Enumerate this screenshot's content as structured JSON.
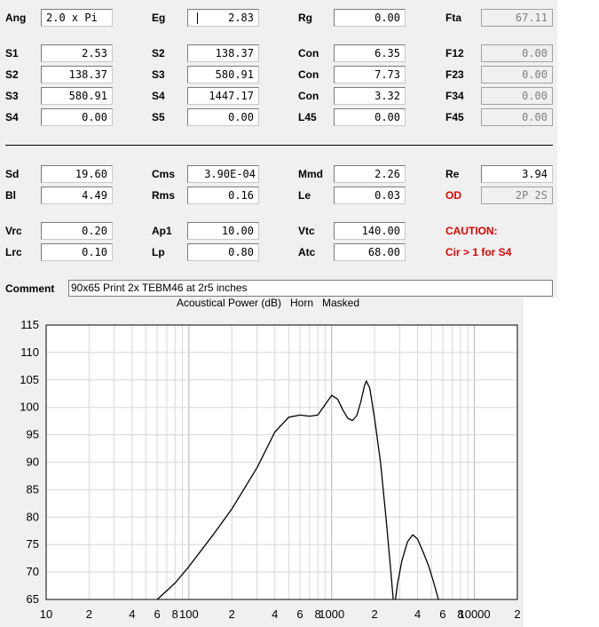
{
  "params": {
    "ang": {
      "label": "Ang",
      "value": "2.0 x Pi"
    },
    "eg": {
      "label": "Eg",
      "value": "2.83"
    },
    "rg": {
      "label": "Rg",
      "value": "0.00"
    },
    "fta": {
      "label": "Fta",
      "value": "67.11"
    },
    "s1": {
      "label": "S1",
      "value": "2.53"
    },
    "s2_c2": {
      "label": "S2",
      "value": "138.37"
    },
    "con1": {
      "label": "Con",
      "value": "6.35"
    },
    "f12": {
      "label": "F12",
      "value": "0.00"
    },
    "s2": {
      "label": "S2",
      "value": "138.37"
    },
    "s3_c2": {
      "label": "S3",
      "value": "580.91"
    },
    "con2": {
      "label": "Con",
      "value": "7.73"
    },
    "f23": {
      "label": "F23",
      "value": "0.00"
    },
    "s3": {
      "label": "S3",
      "value": "580.91"
    },
    "s4_c2": {
      "label": "S4",
      "value": "1447.17"
    },
    "con3": {
      "label": "Con",
      "value": "3.32"
    },
    "f34": {
      "label": "F34",
      "value": "0.00"
    },
    "s4": {
      "label": "S4",
      "value": "0.00"
    },
    "s5": {
      "label": "S5",
      "value": "0.00"
    },
    "l45": {
      "label": "L45",
      "value": "0.00"
    },
    "f45": {
      "label": "F45",
      "value": "0.00"
    },
    "sd": {
      "label": "Sd",
      "value": "19.60"
    },
    "cms": {
      "label": "Cms",
      "value": "3.90E-04"
    },
    "mmd": {
      "label": "Mmd",
      "value": "2.26"
    },
    "re": {
      "label": "Re",
      "value": "3.94"
    },
    "bl": {
      "label": "Bl",
      "value": "4.49"
    },
    "rms": {
      "label": "Rms",
      "value": "0.16"
    },
    "le": {
      "label": "Le",
      "value": "0.03"
    },
    "od": {
      "label": "OD",
      "value": "2P 2S"
    },
    "vrc": {
      "label": "Vrc",
      "value": "0.20"
    },
    "ap1": {
      "label": "Ap1",
      "value": "10.00"
    },
    "vtc": {
      "label": "Vtc",
      "value": "140.00"
    },
    "lrc": {
      "label": "Lrc",
      "value": "0.10"
    },
    "lp": {
      "label": "Lp",
      "value": "0.80"
    },
    "atc": {
      "label": "Atc",
      "value": "68.00"
    }
  },
  "caution": {
    "title": "CAUTION:",
    "message": "Cir > 1 for S4",
    "color": "#e00000"
  },
  "comment": {
    "label": "Comment",
    "value": "90x65 Print 2x  TEBM46 at 2r5 inches"
  },
  "chart_data": {
    "type": "line",
    "title": "Acoustical Power (dB)   Horn   Masked",
    "x_scale": "log",
    "xlim": [
      10,
      20000
    ],
    "ylim": [
      65,
      115
    ],
    "y_ticks": [
      115,
      110,
      105,
      100,
      95,
      90,
      85,
      80,
      75,
      70,
      65
    ],
    "x_ticks": [
      {
        "v": 10,
        "label": "10"
      },
      {
        "v": 20,
        "label": "2"
      },
      {
        "v": 40,
        "label": "4"
      },
      {
        "v": 60,
        "label": "6"
      },
      {
        "v": 80,
        "label": "8"
      },
      {
        "v": 100,
        "label": "100"
      },
      {
        "v": 200,
        "label": "2"
      },
      {
        "v": 400,
        "label": "4"
      },
      {
        "v": 600,
        "label": "6"
      },
      {
        "v": 800,
        "label": "8"
      },
      {
        "v": 1000,
        "label": "1000"
      },
      {
        "v": 2000,
        "label": "2"
      },
      {
        "v": 4000,
        "label": "4"
      },
      {
        "v": 6000,
        "label": "6"
      },
      {
        "v": 8000,
        "label": "8"
      },
      {
        "v": 10000,
        "label": "10000"
      },
      {
        "v": 20000,
        "label": "2"
      }
    ],
    "grid": true,
    "series": [
      {
        "color": "#000000",
        "segments": [
          [
            [
              60,
              65
            ],
            [
              80,
              68
            ],
            [
              100,
              71
            ],
            [
              150,
              77
            ],
            [
              200,
              81.5
            ],
            [
              300,
              89
            ],
            [
              400,
              95.5
            ],
            [
              500,
              98.2
            ],
            [
              600,
              98.6
            ],
            [
              700,
              98.4
            ],
            [
              800,
              98.6
            ],
            [
              900,
              100.5
            ],
            [
              1000,
              102.2
            ],
            [
              1100,
              101.5
            ],
            [
              1200,
              99.5
            ],
            [
              1300,
              98
            ],
            [
              1400,
              97.6
            ],
            [
              1500,
              98.5
            ],
            [
              1600,
              101
            ],
            [
              1700,
              104
            ],
            [
              1750,
              104.8
            ],
            [
              1850,
              103.5
            ],
            [
              2000,
              98
            ],
            [
              2200,
              90
            ],
            [
              2400,
              80
            ],
            [
              2600,
              70
            ],
            [
              2700,
              65
            ]
          ],
          [
            [
              2800,
              65
            ],
            [
              2900,
              68
            ],
            [
              3100,
              72
            ],
            [
              3400,
              75.5
            ],
            [
              3700,
              76.8
            ],
            [
              4000,
              76
            ],
            [
              4400,
              73.5
            ],
            [
              4800,
              71
            ],
            [
              5200,
              68
            ],
            [
              5600,
              65
            ]
          ]
        ]
      }
    ]
  }
}
